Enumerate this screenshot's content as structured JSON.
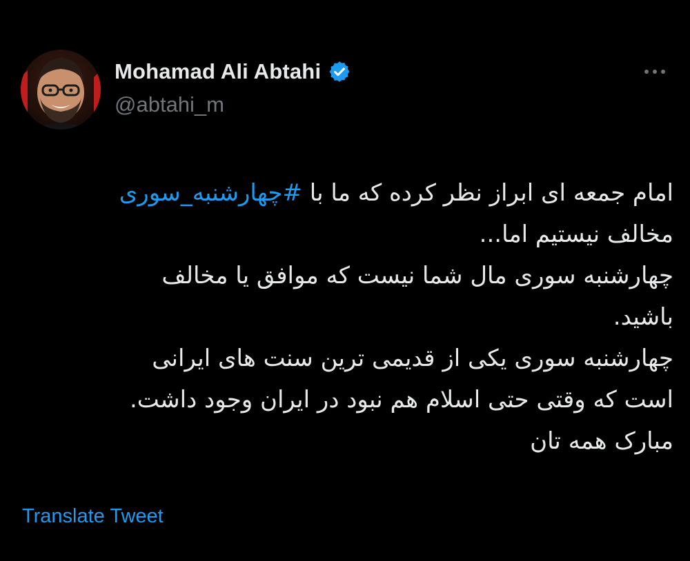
{
  "tweet": {
    "author": {
      "display_name": "Mohamad Ali Abtahi",
      "handle": "@abtahi_m",
      "verified": true,
      "avatar_icon": "profile-photo"
    },
    "more_icon": "more-options-icon",
    "text_lines": {
      "line1_before": "امام جمعه ای ابراز نظر کرده که ما با ",
      "line1_hashtag": "#چهارشنبه_سوری",
      "line2": "مخالف نیستیم اما...",
      "line3": "چهارشنبه سوری مال شما نیست که موافق یا مخالف",
      "line4": "باشید.",
      "line5": "چهارشنبه سوری یکی از قدیمی ترین سنت های ایرانی",
      "line6": "است که وقتی حتی اسلام هم نبود در ایران وجود داشت.",
      "line7": "مبارک همه تان"
    },
    "translate_label": "Translate Tweet"
  },
  "colors": {
    "background": "#000000",
    "primary_text": "#e7e9ea",
    "secondary_text": "#71767b",
    "accent": "#1d9bf0"
  }
}
